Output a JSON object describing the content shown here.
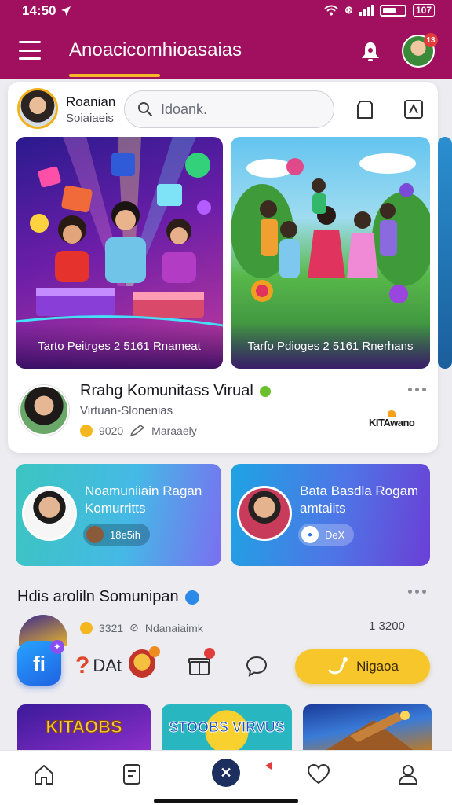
{
  "status_bar": {
    "time": "14:50",
    "battery_text": "107"
  },
  "header": {
    "title": "Anoacicomhioasaias",
    "avatar_badge": "13"
  },
  "profile": {
    "name": "Roanian",
    "subtitle": "Soiaiaeis"
  },
  "search": {
    "placeholder": "Idoank."
  },
  "banners": [
    {
      "caption": "Tarto Peitrges 2 5161 Rnameat"
    },
    {
      "caption": "Tarfo Pdioges 2 5161 Rnerhans"
    }
  ],
  "post": {
    "title": "Rrahg Komunitass Virual",
    "subtitle": "Virtuan-Slonenias",
    "meta_count": "9020",
    "meta_label": "Maraaely",
    "brand": "KITAwano"
  },
  "communities": [
    {
      "title": "Noamuniiain Ragan Komurritts",
      "pill": "18e5ih"
    },
    {
      "title": "Bata Basdla Rogam amtaiits",
      "pill": "DeX"
    }
  ],
  "post2": {
    "title": "Hdis aroliln Somunipan",
    "meta_count": "3321",
    "meta_label": "Ndanaiaimk",
    "count": "1 3200"
  },
  "action_bar": {
    "text": "DAt",
    "cta": "Nigaoa"
  },
  "promos": [
    {
      "label": "KITAOBS"
    },
    {
      "label": "STOOBS VIRVUS"
    },
    {
      "label": ""
    }
  ],
  "colors": {
    "header": "#a0105e",
    "accent": "#f6c62a",
    "fab": "#1f62e2"
  }
}
